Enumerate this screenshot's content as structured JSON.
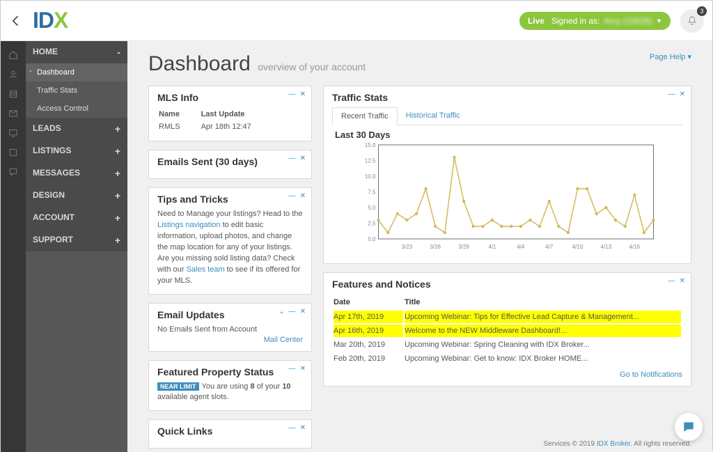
{
  "header": {
    "live": "Live",
    "signed_in": "Signed in as:",
    "user": "Amy (15828)",
    "bell_count": "3"
  },
  "sidebar": {
    "sections": [
      {
        "label": "HOME",
        "open": true,
        "mark": "-"
      },
      {
        "label": "LEADS",
        "open": false,
        "mark": "+"
      },
      {
        "label": "LISTINGS",
        "open": false,
        "mark": "+"
      },
      {
        "label": "MESSAGES",
        "open": false,
        "mark": "+"
      },
      {
        "label": "DESIGN",
        "open": false,
        "mark": "+"
      },
      {
        "label": "ACCOUNT",
        "open": false,
        "mark": "+"
      },
      {
        "label": "SUPPORT",
        "open": false,
        "mark": "+"
      }
    ],
    "home_items": [
      "Dashboard",
      "Traffic Stats",
      "Access Control"
    ]
  },
  "page": {
    "help": "Page Help ▾",
    "title": "Dashboard",
    "subtitle": "overview of your account"
  },
  "mls": {
    "title": "MLS Info",
    "th_name": "Name",
    "th_update": "Last Update",
    "name": "RMLS",
    "update": "Apr 18th 12:47"
  },
  "emails_sent": {
    "title": "Emails Sent (30 days)"
  },
  "tips": {
    "title": "Tips and Tricks",
    "t1": "Need to Manage your listings? Head to the ",
    "l1": "Listings navigation",
    "t2": " to edit basic information, upload photos, and change the map location for any of your listings. Are you missing sold listing data? Check with our ",
    "l2": "Sales team",
    "t3": " to see if its offered for your MLS."
  },
  "updates": {
    "title": "Email Updates",
    "body": "No Emails Sent from Account",
    "link": "Mail Center"
  },
  "featured": {
    "title": "Featured Property Status",
    "badge": "NEAR LIMIT",
    "t1": "You are using ",
    "b1": "8",
    "t2": " of your ",
    "b2": "10",
    "t3": " available agent slots."
  },
  "quick": {
    "title": "Quick Links"
  },
  "traffic": {
    "title": "Traffic Stats",
    "tab1": "Recent Traffic",
    "tab2": "Historical Traffic",
    "chart_title": "Last 30 Days"
  },
  "notices": {
    "title": "Features and Notices",
    "th_date": "Date",
    "th_title": "Title",
    "rows": [
      {
        "date": "Apr 17th, 2019",
        "title": "Upcoming Webinar: Tips for Effective Lead Capture & Management...",
        "hl": true
      },
      {
        "date": "Apr 16th, 2019",
        "title": "Welcome to the NEW Middleware Dashboard!...",
        "hl": true
      },
      {
        "date": "Mar 20th, 2019",
        "title": "Upcoming Webinar: Spring Cleaning with IDX Broker...",
        "hl": false
      },
      {
        "date": "Feb 20th, 2019",
        "title": "Upcoming Webinar: Get to know: IDX Broker HOME...",
        "hl": false
      }
    ],
    "link": "Go to Notifications"
  },
  "footer": {
    "t1": "Services © 2019 ",
    "l": "IDX Broker",
    "t2": ". All rights reserved."
  },
  "chart_data": {
    "type": "line",
    "title": "Last 30 Days",
    "xlabel": "",
    "ylabel": "",
    "ylim": [
      0,
      15
    ],
    "yticks": [
      0,
      2.5,
      5.0,
      7.5,
      10.0,
      12.5,
      15.0
    ],
    "x_major": [
      "3/23",
      "3/26",
      "3/29",
      "4/1",
      "4/4",
      "4/7",
      "4/10",
      "4/13",
      "4/16"
    ],
    "x": [
      "3/20",
      "3/21",
      "3/22",
      "3/23",
      "3/24",
      "3/25",
      "3/26",
      "3/27",
      "3/28",
      "3/29",
      "3/30",
      "3/31",
      "4/1",
      "4/2",
      "4/3",
      "4/4",
      "4/5",
      "4/6",
      "4/7",
      "4/8",
      "4/9",
      "4/10",
      "4/11",
      "4/12",
      "4/13",
      "4/14",
      "4/15",
      "4/16",
      "4/17",
      "4/18"
    ],
    "values": [
      3,
      1,
      4,
      3,
      4,
      8,
      2,
      1,
      13,
      6,
      2,
      2,
      3,
      2,
      2,
      2,
      3,
      2,
      6,
      2,
      1,
      8,
      8,
      4,
      5,
      3,
      2,
      7,
      1,
      3
    ],
    "series_color": "#d4b95a"
  }
}
